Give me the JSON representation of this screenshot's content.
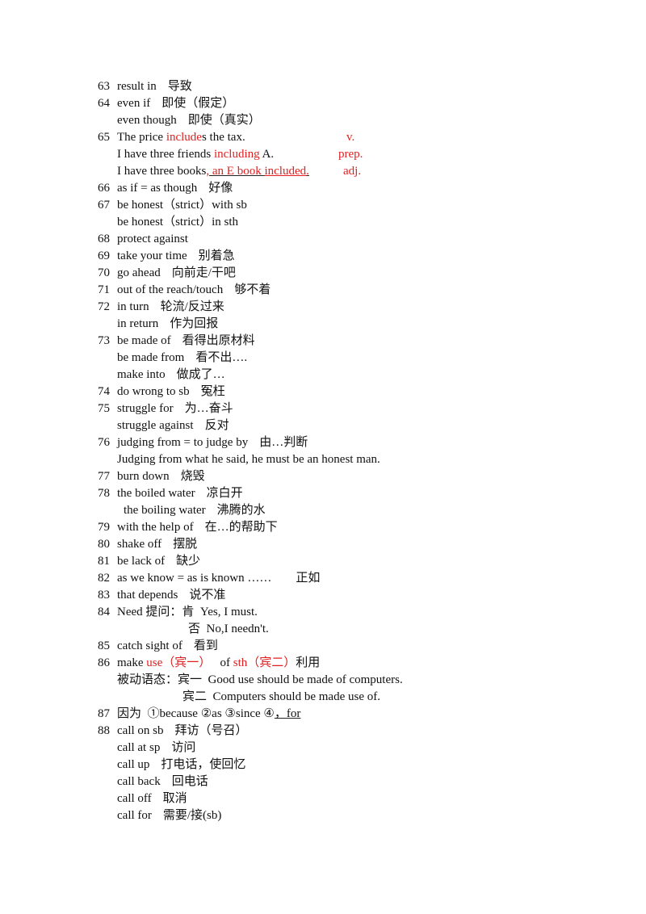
{
  "entries": {
    "e63": {
      "num": "63",
      "en": "result in",
      "zh": "导致"
    },
    "e64a": {
      "num": "64",
      "en": "even if",
      "zh": "即使（假定）"
    },
    "e64b": {
      "en": "even though",
      "zh": "即使（真实）"
    },
    "e65a": {
      "num": "65",
      "pre": "The price ",
      "red": "include",
      "post": "s the tax.",
      "pos": "v."
    },
    "e65b": {
      "pre": "I have three friends ",
      "red": "including",
      "post": " A.",
      "pos": "prep."
    },
    "e65c": {
      "pre": "I have three books",
      "ul1": ", an E book ",
      "red": "included",
      "ul2": ".",
      "pos": "adj."
    },
    "e66": {
      "num": "66",
      "en": "as if = as though",
      "zh": "好像"
    },
    "e67a": {
      "num": "67",
      "en": "be honest（strict）with sb"
    },
    "e67b": {
      "en": "be honest（strict）in sth"
    },
    "e68": {
      "num": "68",
      "en": "protect against"
    },
    "e69": {
      "num": "69",
      "en": "take your time",
      "zh": "别着急"
    },
    "e70": {
      "num": "70",
      "en": "go ahead",
      "zh": "向前走/干吧"
    },
    "e71": {
      "num": "71",
      "en": "out of the reach/touch",
      "zh": "够不着"
    },
    "e72a": {
      "num": "72",
      "en": "in turn",
      "zh": "轮流/反过来"
    },
    "e72b": {
      "en": "in return",
      "zh": "作为回报"
    },
    "e73a": {
      "num": "73",
      "en": "be made of",
      "zh": "看得出原材料"
    },
    "e73b": {
      "en": "be made from",
      "zh": "看不出…."
    },
    "e73c": {
      "en": "make into",
      "zh": "做成了…"
    },
    "e74": {
      "num": "74",
      "en": "do wrong to sb",
      "zh": "冤枉"
    },
    "e75a": {
      "num": "75",
      "en": "struggle for",
      "zh": "为…奋斗"
    },
    "e75b": {
      "en": "struggle against",
      "zh": "反对"
    },
    "e76a": {
      "num": "76",
      "en": "judging from = to judge by",
      "zh": "由…判断"
    },
    "e76b": {
      "en": "Judging from what he said, he must be an honest man."
    },
    "e77": {
      "num": "77",
      "en": "burn down",
      "zh": "烧毁"
    },
    "e78a": {
      "num": "78",
      "en": "the boiled water",
      "zh": "凉白开"
    },
    "e78b": {
      "en": "the boiling water",
      "zh": "沸腾的水"
    },
    "e79": {
      "num": "79",
      "en": "with the help of",
      "zh": "在…的帮助下"
    },
    "e80": {
      "num": "80",
      "en": "shake off",
      "zh": "摆脱"
    },
    "e81": {
      "num": "81",
      "en": "be lack of",
      "zh": "缺少"
    },
    "e82": {
      "num": "82",
      "en": "as we know = as is known ……",
      "zh": "正如"
    },
    "e83": {
      "num": "83",
      "en": "that depends",
      "zh": "说不准"
    },
    "e84a": {
      "num": "84",
      "en": "Need 提问：肯  Yes, I must."
    },
    "e84b": {
      "en": "否  No,I needn't."
    },
    "e85": {
      "num": "85",
      "en": "catch sight of",
      "zh": "看到"
    },
    "e86a": {
      "num": "86",
      "pre": "make ",
      "red1": "use（宾一）",
      "mid": "   of ",
      "red2": "sth（宾二）",
      "post": "利用"
    },
    "e86b": {
      "en": "被动语态：宾一  Good use should be made of computers."
    },
    "e86c": {
      "en": "宾二  Computers should be made use of."
    },
    "e87": {
      "num": "87",
      "pre": "因为  ①because ②as ③since ④",
      "ul": "，for"
    },
    "e88a": {
      "num": "88",
      "en": "call on sb",
      "zh": "拜访（号召）"
    },
    "e88b": {
      "en": "call at sp",
      "zh": "访问"
    },
    "e88c": {
      "en": "call up",
      "zh": "打电话，使回忆"
    },
    "e88d": {
      "en": "call back",
      "zh": "回电话"
    },
    "e88e": {
      "en": "call off",
      "zh": "取消"
    },
    "e88f": {
      "en": "call for",
      "zh": "需要/接(sb)"
    }
  }
}
